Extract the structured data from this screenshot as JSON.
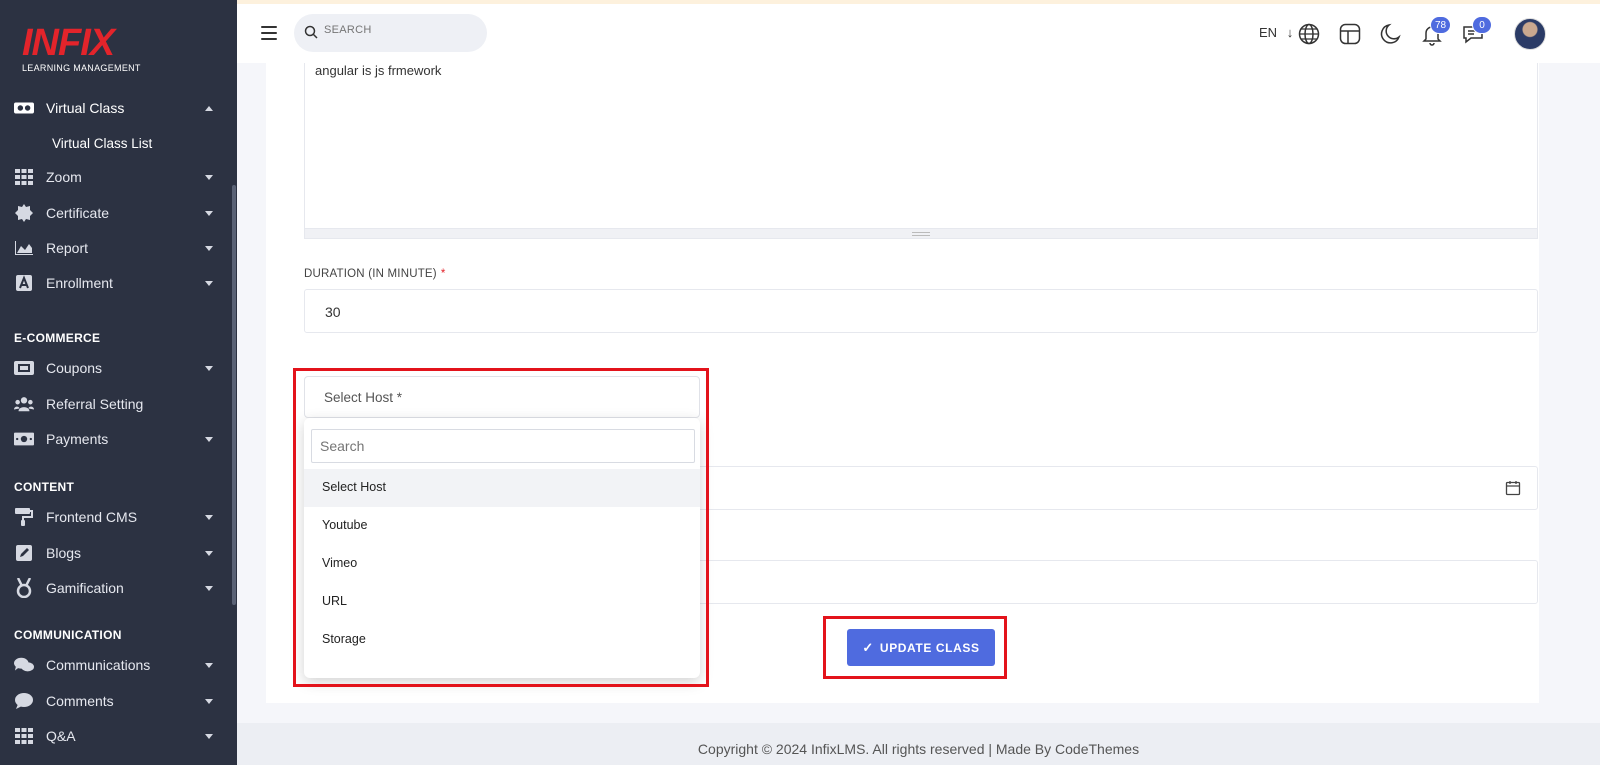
{
  "logo": {
    "brand": "INFIX",
    "subtitle": "LEARNING MANAGEMENT"
  },
  "sidebar": {
    "items": [
      {
        "label": "Virtual Class",
        "icon": "vr-glasses-icon"
      },
      {
        "label": "Virtual Class List"
      },
      {
        "label": "Zoom",
        "icon": "grid-icon"
      },
      {
        "label": "Certificate",
        "icon": "badge-icon"
      },
      {
        "label": "Report",
        "icon": "chart-icon"
      },
      {
        "label": "Enrollment",
        "icon": "enroll-icon"
      },
      {
        "label": "Coupons",
        "icon": "ticket-icon"
      },
      {
        "label": "Referral Setting",
        "icon": "users-icon"
      },
      {
        "label": "Payments",
        "icon": "money-icon"
      },
      {
        "label": "Frontend CMS",
        "icon": "paint-roller-icon"
      },
      {
        "label": "Blogs",
        "icon": "pen-icon"
      },
      {
        "label": "Gamification",
        "icon": "medal-icon"
      },
      {
        "label": "Communications",
        "icon": "chat-icon"
      },
      {
        "label": "Comments",
        "icon": "comment-icon"
      },
      {
        "label": "Q&A",
        "icon": "grid-icon"
      }
    ],
    "sections": {
      "ecommerce": "E-COMMERCE",
      "content": "CONTENT",
      "communication": "COMMUNICATION"
    }
  },
  "header": {
    "search_placeholder": "SEARCH",
    "language": "EN",
    "notifications_count": "78",
    "messages_count": "0"
  },
  "form": {
    "description_text": "angular is js frmework",
    "duration_label": "DURATION (IN MINUTE)",
    "duration_required": "*",
    "duration_value": "30",
    "host_select_value": "Select Host *",
    "host_search_placeholder": "Search",
    "host_options": [
      "Select Host",
      "Youtube",
      "Vimeo",
      "URL",
      "Storage"
    ],
    "update_button": "UPDATE CLASS",
    "update_check": "✓"
  },
  "footer": {
    "copyright": "Copyright © 2024 InfixLMS. All rights reserved | Made By CodeThemes"
  },
  "colors": {
    "accent": "#4f6bdf",
    "sidebar_bg": "#2c3242",
    "highlight": "#e3131b",
    "brand": "#e3242b"
  }
}
